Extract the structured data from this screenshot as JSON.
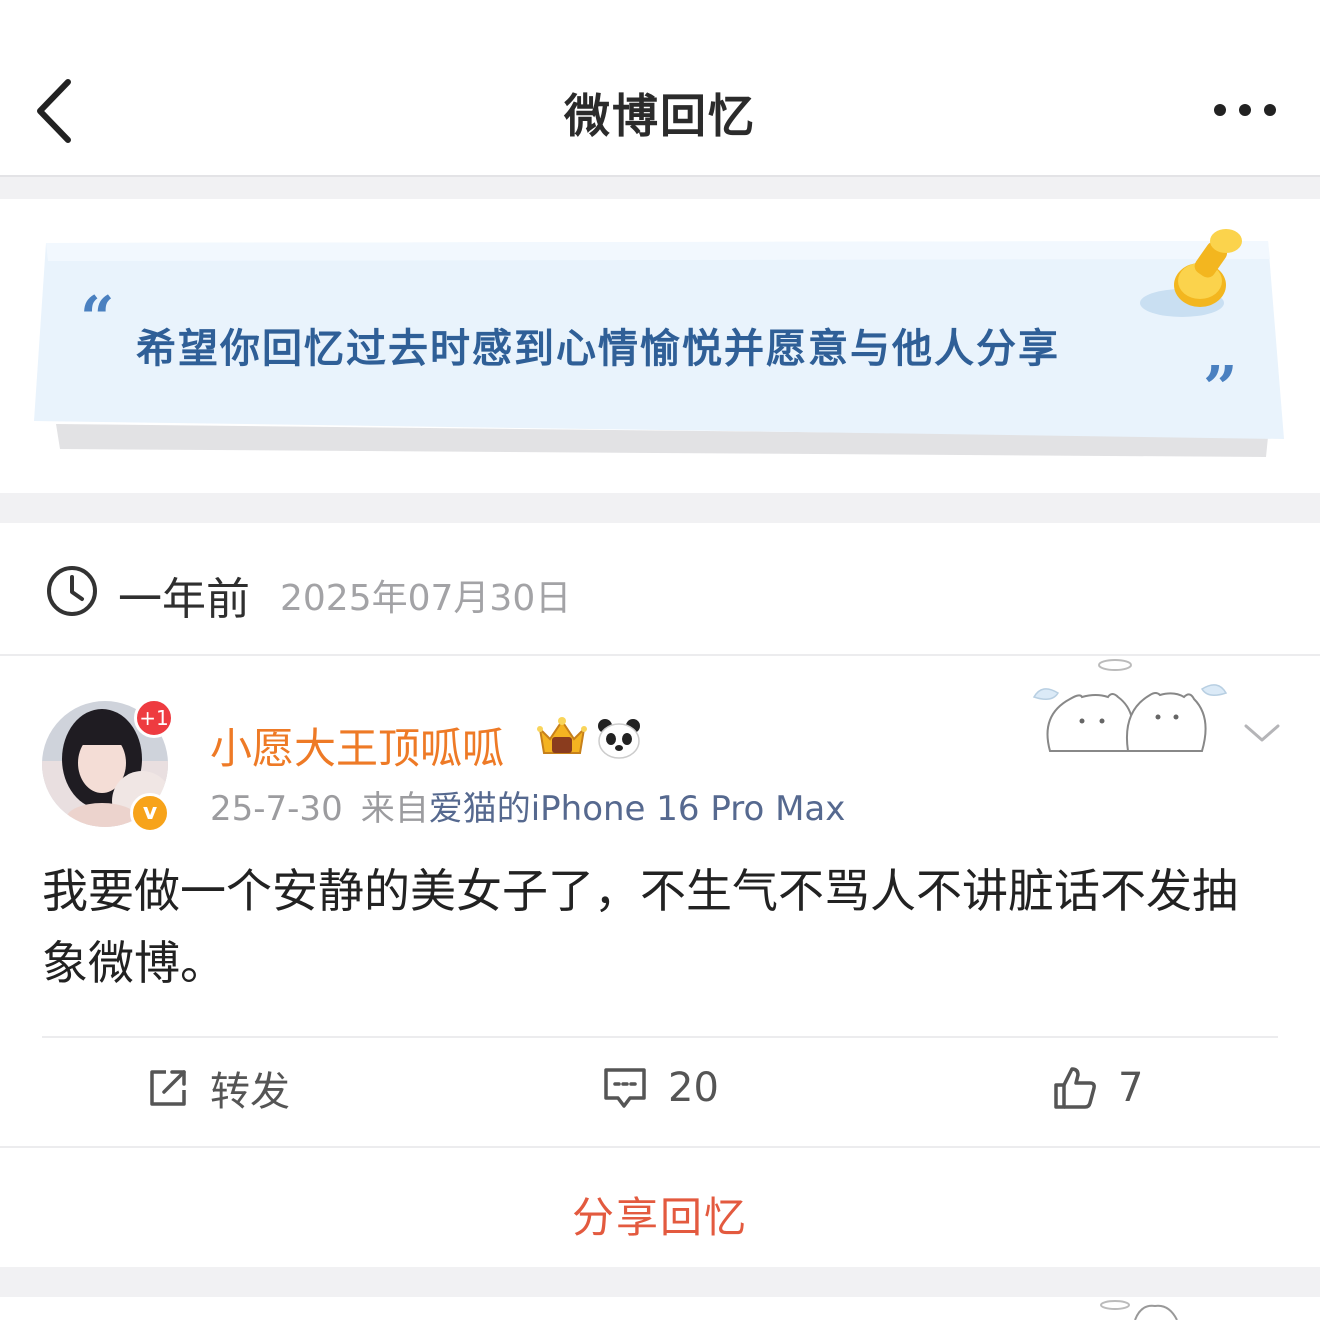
{
  "header": {
    "title": "微博回忆",
    "back_icon": "chevron-left-icon",
    "more_icon": "more-dots-icon"
  },
  "banner": {
    "text": "希望你回忆过去时感到心情愉悦并愿意与他人分享",
    "quote_open": "“",
    "quote_close": "”"
  },
  "memory": {
    "time_ago": "一年前",
    "date": "2025年07月30日"
  },
  "post": {
    "username": "小愿大王顶呱呱",
    "avatar_badge": "+1",
    "verify_badge": "v",
    "date": "25-7-30",
    "from_label": "来自",
    "source": "爱猫的iPhone 16 Pro Max",
    "text": "我要做一个安静的美女子了，不生气不骂人不讲脏话不发抽象微博。",
    "actions": {
      "repost_label": "转发",
      "comment_count": "20",
      "like_count": "7"
    }
  },
  "share_button": "分享回忆",
  "colors": {
    "username": "#ee7a26",
    "source_link": "#56698f",
    "share": "#e35a3f",
    "banner_text": "#2f5f97"
  }
}
